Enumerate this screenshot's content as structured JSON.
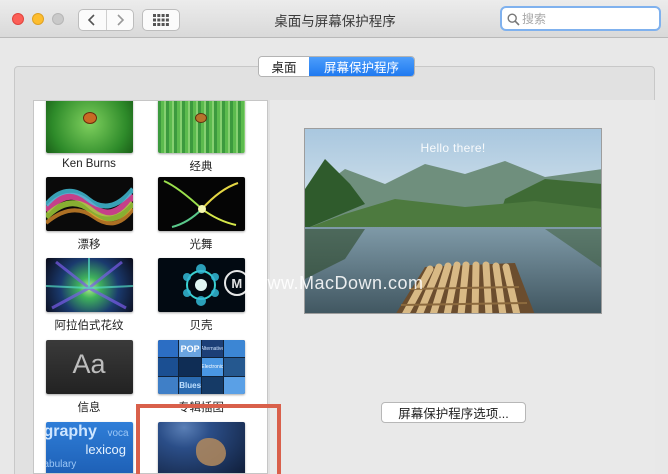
{
  "window": {
    "title": "桌面与屏幕保护程序"
  },
  "search": {
    "placeholder": "搜索"
  },
  "tabs": [
    {
      "label": "桌面",
      "active": false
    },
    {
      "label": "屏幕保护程序",
      "active": true
    }
  ],
  "savers": [
    {
      "label": "Ken Burns"
    },
    {
      "label": "经典"
    },
    {
      "label": "漂移"
    },
    {
      "label": "光舞"
    },
    {
      "label": "阿拉伯式花纹"
    },
    {
      "label": "贝壳"
    },
    {
      "label": "信息",
      "glyph": "Aa"
    },
    {
      "label": "专辑插图",
      "tiles": [
        "POP",
        "Alternative",
        "Electronic",
        "Blues"
      ]
    },
    {
      "words": [
        "graphy",
        "lexicog",
        "abulary",
        "voca"
      ]
    },
    {
      "label": ""
    }
  ],
  "preview": {
    "caption": "Hello there!"
  },
  "watermark": {
    "text": "www.MacDown.com",
    "logo": "M"
  },
  "options_button": {
    "label": "屏幕保护程序选项..."
  },
  "colors": {
    "accent": "#1f79f0",
    "highlight": "#d9604b"
  }
}
